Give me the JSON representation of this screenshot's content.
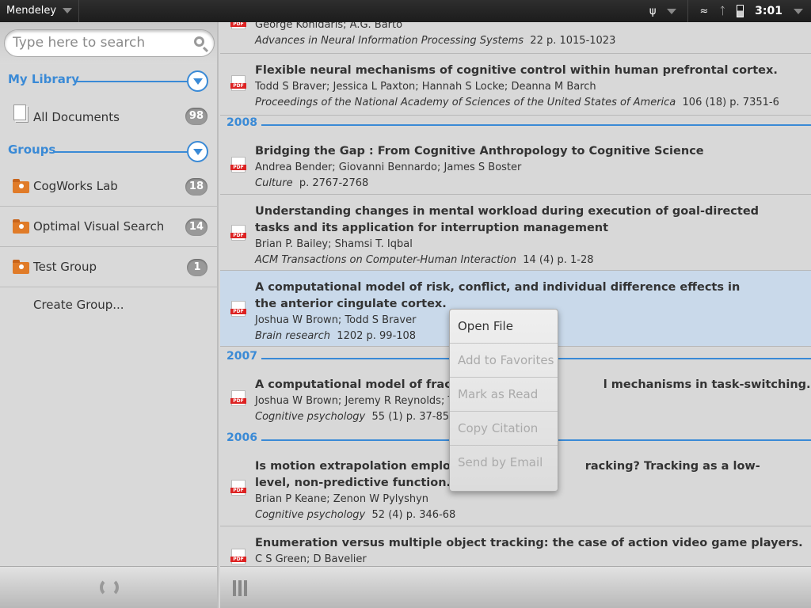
{
  "status_bar": {
    "app_name": "Mendeley",
    "time": "3:01",
    "icons": [
      "usb-icon",
      "wifi-icon",
      "bluetooth-icon",
      "battery-icon"
    ]
  },
  "sidebar": {
    "search_placeholder": "Type here to search",
    "my_library": "My Library",
    "all_documents": {
      "label": "All Documents",
      "count": "98"
    },
    "groups_label": "Groups",
    "groups": [
      {
        "label": "CogWorks Lab",
        "count": "18"
      },
      {
        "label": "Optimal Visual Search",
        "count": "14"
      },
      {
        "label": "Test Group",
        "count": "1"
      }
    ],
    "create_group": "Create Group..."
  },
  "documents": [
    {
      "authors": "George Konidaris; A.G. Barto",
      "journal": "Advances in Neural Information Processing Systems",
      "details": "22  p. 1015-1023"
    },
    {
      "title": "Flexible neural mechanisms of cognitive control within human prefrontal cortex.",
      "authors": "Todd S Braver; Jessica L Paxton; Hannah S Locke; Deanna M Barch",
      "journal": "Proceedings of the National Academy of Sciences of the United States of America",
      "details": "106  (18)  p. 7351-6"
    },
    {
      "year": "2008"
    },
    {
      "title": "Bridging the Gap : From Cognitive Anthropology to Cognitive Science",
      "authors": "Andrea Bender; Giovanni Bennardo; James S Boster",
      "journal": "Culture",
      "details": "p. 2767-2768"
    },
    {
      "title": "Understanding changes in mental workload during execution of goal-directed tasks and its application for interruption management",
      "authors": "Brian P. Bailey; Shamsi T. Iqbal",
      "journal": "ACM Transactions on Computer-Human Interaction",
      "details": "14  (4)  p. 1-28"
    },
    {
      "title": "A computational model of risk, conflict, and individual difference effects in the anterior cingulate cortex.",
      "authors": "Joshua W Brown; Todd S Braver",
      "journal": "Brain research",
      "details": "1202  p. 99-108",
      "selected": true
    },
    {
      "year": "2007"
    },
    {
      "title_visible_start": "A computational model of fractiona",
      "title_visible_end": "l mechanisms in task-switching.",
      "authors": "Joshua W Brown; Jeremy R Reynolds; To",
      "journal": "Cognitive psychology",
      "details": "55  (1)  p. 37-85"
    },
    {
      "year": "2006"
    },
    {
      "title_visible_start": "Is motion extrapolation employed",
      "title_visible_end": "racking? Tracking as a low-level, non-predictive function.",
      "authors": "Brian P Keane; Zenon W Pylyshyn",
      "journal": "Cognitive psychology",
      "details": "52  (4)  p. 346-68"
    },
    {
      "title": "Enumeration versus multiple object tracking: the case of action video game players.",
      "authors": "C S Green; D Bavelier"
    }
  ],
  "context_menu": [
    {
      "label": "Open File",
      "enabled": true
    },
    {
      "label": "Add to Favorites",
      "enabled": false
    },
    {
      "label": "Mark as Read",
      "enabled": false
    },
    {
      "label": "Copy Citation",
      "enabled": false
    },
    {
      "label": "Send by Email",
      "enabled": false
    }
  ],
  "colors": {
    "accent": "#3a8ad6",
    "selected_row": "#c9d9ea",
    "pdf_badge": "#dd2222"
  }
}
